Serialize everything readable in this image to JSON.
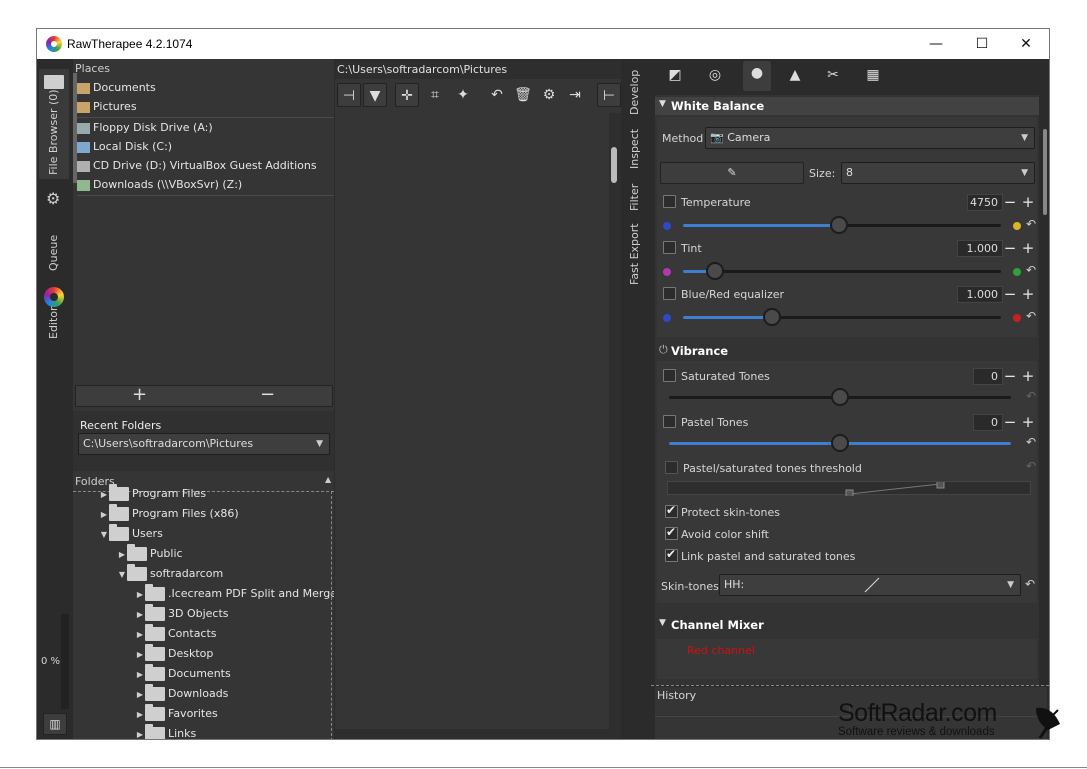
{
  "window": {
    "title": "RawTherapee 4.2.1074"
  },
  "titlebar": {
    "minimize": "—",
    "maximize": "☐",
    "close": "✕"
  },
  "vtabs": {
    "file_browser": "File Browser (0)",
    "queue": "Queue",
    "editor": "Editor"
  },
  "places": {
    "header": "Places",
    "items": [
      {
        "label": "Documents"
      },
      {
        "label": "Pictures"
      },
      {
        "label": "Floppy Disk Drive (A:)"
      },
      {
        "label": "Local Disk (C:)"
      },
      {
        "label": "CD Drive (D:) VirtualBox Guest Additions"
      },
      {
        "label": "Downloads (\\\\VBoxSvr) (Z:)"
      }
    ],
    "add_label": "+",
    "remove_label": "−"
  },
  "recent": {
    "header": "Recent Folders",
    "value": "C:\\Users\\softradarcom\\Pictures"
  },
  "folders": {
    "header": "Folders",
    "items": [
      {
        "label": "Program Files"
      },
      {
        "label": "Program Files (x86)"
      },
      {
        "label": "Users"
      },
      {
        "label": "Public"
      },
      {
        "label": "softradarcom"
      },
      {
        "label": ".Icecream PDF Split and Merge"
      },
      {
        "label": "3D Objects"
      },
      {
        "label": "Contacts"
      },
      {
        "label": "Desktop"
      },
      {
        "label": "Documents"
      },
      {
        "label": "Downloads"
      },
      {
        "label": "Favorites"
      },
      {
        "label": "Links"
      }
    ]
  },
  "queue_progress": "0 %",
  "browser": {
    "path": "C:\\Users\\softradarcom\\Pictures"
  },
  "right_tabs": {
    "develop": "Develop",
    "inspect": "Inspect",
    "filter": "Filter",
    "fast_export": "Fast Export"
  },
  "wb": {
    "header": "White Balance",
    "method_label": "Method",
    "method_value": "Camera",
    "size_label": "Size:",
    "size_value": "8",
    "temperature": {
      "label": "Temperature",
      "value": "4750",
      "level": 0.49
    },
    "tint": {
      "label": "Tint",
      "value": "1.000",
      "level": 0.1
    },
    "equalizer": {
      "label": "Blue/Red equalizer",
      "value": "1.000",
      "level": 0.28
    }
  },
  "vibrance": {
    "header": "Vibrance",
    "saturated": {
      "label": "Saturated Tones",
      "value": "0",
      "level": 0.5
    },
    "pastel": {
      "label": "Pastel Tones",
      "value": "0",
      "level": 0.5
    },
    "threshold_label": "Pastel/saturated tones threshold",
    "protect_label": "Protect skin-tones",
    "avoid_label": "Avoid color shift",
    "link_label": "Link pastel and saturated tones",
    "skin_label": "Skin-tones:",
    "skin_value": "HH:"
  },
  "channel_mixer": {
    "header": "Channel Mixer",
    "red_channel": "Red channel"
  },
  "history": {
    "header": "History"
  },
  "watermark": {
    "brand": "SoftRadar.com",
    "tagline": "Software reviews & downloads"
  },
  "colors": {
    "accent": "#3f7fd0",
    "panel": "#353535",
    "bg": "#2b2b2b"
  }
}
